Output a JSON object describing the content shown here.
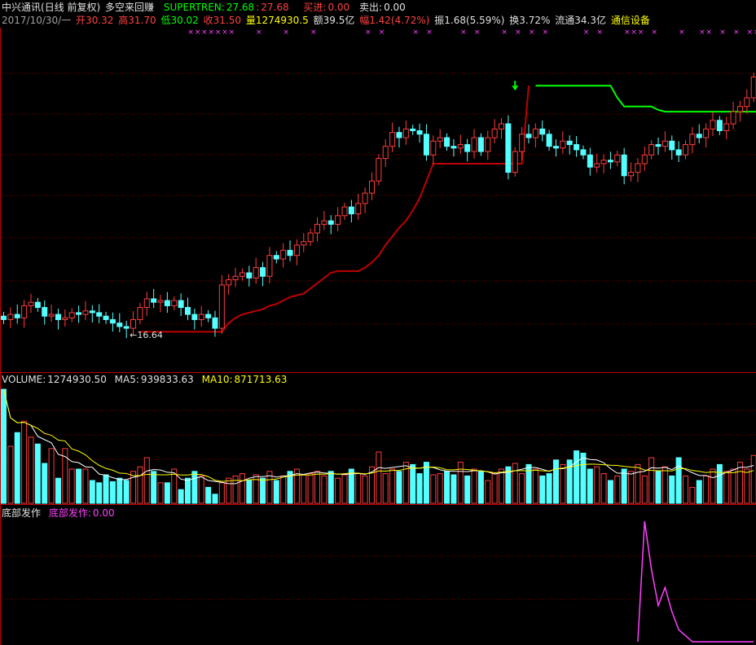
{
  "header": {
    "security": "中兴通讯",
    "mode": "(日线 前复权)",
    "indicator_name": "多空来回赚",
    "supertrend_label": "SUPERTREN:",
    "supertrend_value1": "27.68",
    "supertrend_sep": ":",
    "supertrend_value2": "27.68",
    "buy_label": "买进:",
    "buy_value": "0.00",
    "sell_label": "卖出:",
    "sell_value": "0.00"
  },
  "quote": {
    "date": "2017/10/30/一",
    "open_label": "开",
    "open": "30.32",
    "high_label": "高",
    "high": "31.70",
    "low_label": "低",
    "low": "30.02",
    "close_label": "收",
    "close": "31.50",
    "volume_label": "量",
    "volume": "1274930.5",
    "amount_label": "额",
    "amount": "39.5亿",
    "change_label": "幅",
    "change": "1.42(4.72%)",
    "amplitude_label": "振",
    "amplitude": "1.68(5.59%)",
    "turnover_label": "换",
    "turnover": "3.72%",
    "float_label": "流通",
    "float_cap": "34.3亿",
    "sector": "通信设备"
  },
  "volume_panel": {
    "label": "VOLUME:",
    "value": "1274930.50",
    "ma5_label": "MA5:",
    "ma5": "939833.63",
    "ma10_label": "MA10:",
    "ma10": "871713.63"
  },
  "bottom_panel": {
    "name": "底部发作",
    "label": "底部发作:",
    "value": "0.00"
  },
  "price_annotation": "16.64",
  "colors": {
    "up": "#ff3c3c",
    "down": "#54ffff",
    "supertrend_up": "#c00000",
    "supertrend_down": "#00ff00",
    "ma5": "#ffffff",
    "ma10": "#ffff00",
    "bottom_line": "#ff40ff",
    "grid": "#7a0000"
  },
  "chart_data": {
    "type": "candlestick",
    "ylim": [
      15.5,
      33.5
    ],
    "open": [
      17.7,
      17.5,
      17.8,
      17.6,
      18.3,
      18.5,
      18.2,
      17.7,
      17.8,
      17.5,
      17.6,
      17.9,
      17.8,
      18.0,
      17.9,
      17.7,
      17.5,
      17.3,
      17.1,
      17.0,
      17.5,
      18.2,
      18.7,
      18.5,
      18.6,
      18.3,
      18.6,
      18.2,
      17.8,
      17.5,
      17.8,
      17.6,
      17.0,
      19.5,
      19.8,
      20.0,
      20.2,
      19.9,
      20.5,
      20.0,
      21.2,
      21.0,
      21.5,
      21.2,
      21.8,
      22.0,
      22.5,
      23.0,
      23.2,
      23.0,
      23.5,
      24.0,
      23.6,
      24.2,
      24.8,
      25.5,
      26.8,
      27.5,
      28.3,
      28.0,
      28.5,
      28.4,
      28.2,
      27.0,
      27.8,
      28.0,
      27.5,
      27.4,
      27.6,
      27.2,
      28.0,
      27.2,
      28.0,
      28.5,
      28.8,
      26.0,
      27.2,
      28.2,
      28.0,
      28.5,
      28.2,
      27.5,
      27.4,
      27.8,
      27.6,
      27.3,
      27.0,
      26.3,
      26.5,
      26.7,
      26.6,
      27.0,
      25.8,
      26.0,
      26.5,
      27.0,
      27.6,
      27.5,
      27.8,
      27.3,
      27.0,
      27.6,
      28.2,
      28.0,
      28.5,
      29.0,
      28.4,
      28.8,
      29.5,
      29.8,
      30.3
    ],
    "close": [
      17.5,
      17.8,
      17.6,
      18.3,
      18.5,
      18.2,
      17.7,
      17.8,
      17.5,
      17.6,
      17.9,
      17.8,
      18.0,
      17.9,
      17.7,
      17.5,
      17.3,
      17.1,
      17.0,
      17.5,
      18.2,
      18.7,
      18.5,
      18.6,
      18.3,
      18.6,
      18.2,
      17.8,
      17.5,
      17.8,
      17.6,
      17.0,
      19.5,
      19.8,
      20.0,
      20.2,
      19.9,
      20.5,
      20.0,
      21.2,
      21.0,
      21.5,
      21.2,
      21.8,
      22.0,
      22.5,
      23.0,
      23.2,
      23.0,
      23.5,
      24.0,
      23.6,
      24.2,
      24.8,
      25.5,
      26.8,
      27.5,
      28.3,
      28.0,
      28.5,
      28.4,
      28.2,
      27.0,
      27.8,
      28.0,
      27.5,
      27.4,
      27.6,
      27.2,
      28.0,
      27.2,
      28.0,
      28.5,
      28.8,
      26.0,
      27.2,
      28.2,
      28.0,
      28.5,
      28.2,
      27.5,
      27.4,
      27.8,
      27.6,
      27.3,
      27.0,
      26.3,
      26.5,
      26.7,
      26.6,
      27.0,
      25.8,
      26.0,
      26.5,
      27.0,
      27.6,
      27.5,
      27.8,
      27.3,
      27.0,
      27.6,
      28.2,
      28.0,
      28.5,
      29.0,
      28.4,
      28.8,
      29.5,
      29.8,
      30.3,
      31.5
    ],
    "supertrend": [
      null,
      null,
      null,
      null,
      null,
      null,
      null,
      null,
      null,
      null,
      null,
      null,
      null,
      null,
      null,
      null,
      null,
      null,
      null,
      null,
      16.8,
      16.8,
      16.8,
      16.8,
      16.8,
      16.8,
      16.8,
      16.8,
      16.8,
      16.8,
      16.8,
      16.8,
      16.8,
      17.3,
      17.6,
      17.8,
      17.9,
      18.0,
      18.1,
      18.3,
      18.4,
      18.6,
      18.8,
      18.9,
      19.0,
      19.3,
      19.6,
      19.9,
      20.2,
      20.3,
      20.3,
      20.3,
      20.3,
      20.5,
      20.8,
      21.2,
      21.8,
      22.3,
      22.8,
      23.2,
      23.8,
      24.5,
      25.5,
      26.5,
      26.5,
      26.5,
      26.5,
      26.5,
      26.5,
      26.5,
      26.5,
      26.5,
      26.5,
      26.5,
      26.5,
      26.5,
      26.5,
      31.0,
      31.0,
      31.0,
      31.0,
      31.0,
      31.0,
      31.0,
      31.0,
      31.0,
      31.0,
      31.0,
      31.0,
      31.0,
      30.3,
      29.8,
      29.8,
      29.8,
      29.8,
      29.8,
      29.6,
      29.5,
      29.5,
      29.5,
      29.5,
      29.5,
      29.5,
      29.5,
      29.5,
      29.5,
      29.5,
      29.5,
      29.5,
      29.5,
      29.5,
      29.5,
      29.5,
      29.5,
      29.5,
      29.5,
      25.7,
      26.5,
      26.5,
      26.6,
      26.9,
      26.9,
      26.9,
      26.9,
      27.3,
      27.5
    ],
    "supertrend_side": "red-up / green-down",
    "buy_marker_index": 117,
    "sell_marker_index": 75,
    "volume": [
      100,
      50,
      62,
      72,
      58,
      52,
      35,
      48,
      22,
      48,
      30,
      30,
      30,
      20,
      18,
      25,
      19,
      22,
      20,
      28,
      32,
      40,
      28,
      18,
      18,
      30,
      12,
      22,
      28,
      24,
      14,
      8,
      18,
      22,
      24,
      26,
      20,
      25,
      22,
      28,
      20,
      24,
      28,
      30,
      25,
      26,
      28,
      24,
      28,
      22,
      25,
      30,
      26,
      24,
      32,
      45,
      26,
      30,
      28,
      36,
      34,
      26,
      36,
      25,
      26,
      28,
      25,
      36,
      24,
      30,
      28,
      20,
      26,
      30,
      32,
      35,
      26,
      34,
      30,
      24,
      26,
      38,
      34,
      38,
      46,
      44,
      30,
      32,
      26,
      20,
      24,
      30,
      28,
      34,
      24,
      40,
      28,
      32,
      24,
      40,
      24,
      14,
      20,
      24,
      30,
      34,
      28,
      30,
      36,
      30,
      42
    ],
    "bottom_signal": [
      0,
      0,
      0,
      0,
      0,
      0,
      0,
      0,
      0,
      0,
      0,
      0,
      0,
      0,
      0,
      0,
      0,
      0,
      0,
      0,
      0,
      0,
      0,
      0,
      0,
      0,
      0,
      0,
      0,
      0,
      0,
      0,
      0,
      0,
      0,
      0,
      0,
      0,
      0,
      0,
      0,
      0,
      0,
      0,
      0,
      0,
      0,
      0,
      0,
      0,
      0,
      0,
      0,
      0,
      0,
      0,
      0,
      0,
      0,
      0,
      0,
      0,
      0,
      0,
      0,
      0,
      0,
      0,
      0,
      0,
      0,
      0,
      0,
      0,
      0,
      0,
      0,
      0,
      0,
      0,
      0,
      0,
      0,
      0,
      0,
      0,
      0,
      0,
      0,
      0,
      0,
      0,
      0,
      0,
      100,
      60,
      30,
      45,
      25,
      10,
      5,
      0,
      0,
      0,
      0,
      0,
      0,
      0,
      0,
      0,
      0
    ],
    "xmark_indices": [
      26,
      27,
      28,
      29,
      30,
      31,
      32,
      36,
      40,
      44,
      52,
      54,
      59,
      61,
      66,
      68,
      72,
      74,
      76,
      78,
      84,
      86,
      90,
      91,
      92,
      94,
      98,
      101,
      102,
      104,
      106,
      108,
      109,
      110,
      111,
      112,
      114,
      116,
      118,
      120,
      123,
      126
    ],
    "grid": true
  }
}
